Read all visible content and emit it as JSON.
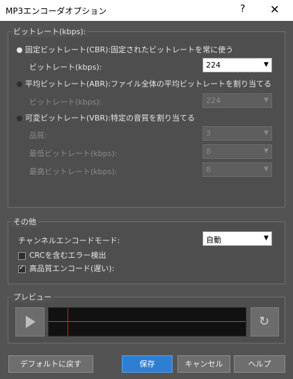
{
  "window": {
    "title": "MP3エンコーダオプション",
    "help": "?",
    "close": "✕"
  },
  "bitrate_group": {
    "legend": "ビットレート(kbps):",
    "cbr_label": "固定ビットレート(CBR):固定されたビットレートを常に使う",
    "cbr_bitrate_label": "ビットレート(kbps):",
    "cbr_bitrate_value": "224",
    "abr_label": "平均ビットレート(ABR):ファイル全体の平均ビットレートを割り当てる",
    "abr_bitrate_label": "ビットレート(kbps):",
    "abr_bitrate_value": "224",
    "vbr_label": "可変ビットレート(VBR):特定の音質を割り当てる",
    "quality_label": "品質:",
    "quality_value": "3",
    "min_label": "最低ビットレート(kbps):",
    "min_value": "8",
    "max_label": "最高ビットレート(kbps):",
    "max_value": "8"
  },
  "other_group": {
    "legend": "その他",
    "channel_label": "チャンネルエンコードモード:",
    "channel_value": "自動",
    "crc_label": "CRCを含むエラー検出",
    "crc_checked": false,
    "hq_label": "高品質エンコード(遅い):",
    "hq_checked": true
  },
  "preview_group": {
    "legend": "プレビュー"
  },
  "buttons": {
    "default": "デフォルトに戻す",
    "save": "保存",
    "cancel": "キャンセル",
    "help": "ヘルプ"
  }
}
